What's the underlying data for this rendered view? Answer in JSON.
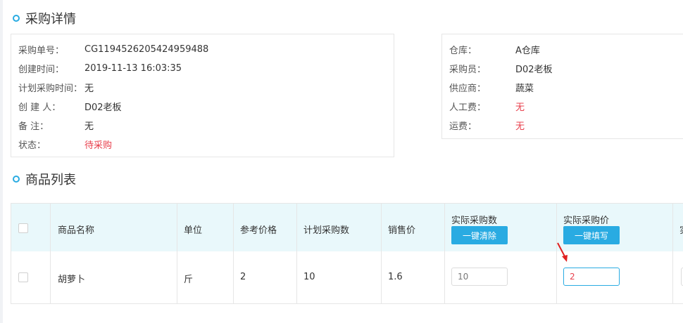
{
  "purchase_details": {
    "title": "采购详情",
    "left": [
      {
        "label": "采购单号：",
        "value": "CG1194526205424959488"
      },
      {
        "label": "创建时间：",
        "value": "2019-11-13 16:03:35"
      },
      {
        "label": "计划采购时间：",
        "value": "无"
      },
      {
        "label": "创 建 人：",
        "value": "D02老板"
      },
      {
        "label": "备 注：",
        "value": "无"
      },
      {
        "label": "状态：",
        "value": "待采购"
      }
    ],
    "right": [
      {
        "label": "仓库：",
        "value": "A仓库"
      },
      {
        "label": "采购员：",
        "value": "D02老板"
      },
      {
        "label": "供应商：",
        "value": "蔬菜"
      },
      {
        "label": "人工费：",
        "value": "无"
      },
      {
        "label": "运费：",
        "value": "无"
      }
    ]
  },
  "product_list": {
    "title": "商品列表",
    "columns": [
      "商品名称",
      "单位",
      "参考价格",
      "计划采购数",
      "销售价",
      "实际采购数",
      "实际采购价",
      "实"
    ],
    "clear_button": "一键清除",
    "fill_button": "一键填写",
    "rows": [
      {
        "name": "胡萝卜",
        "unit": "斤",
        "ref_price": "2",
        "planned_qty": "10",
        "sale_price": "1.6",
        "actual_qty": "10",
        "actual_price": "2"
      }
    ]
  },
  "colors": {
    "accent": "#29abe2",
    "status_red": "#e8404d",
    "header_bg": "#e9f8fb"
  }
}
